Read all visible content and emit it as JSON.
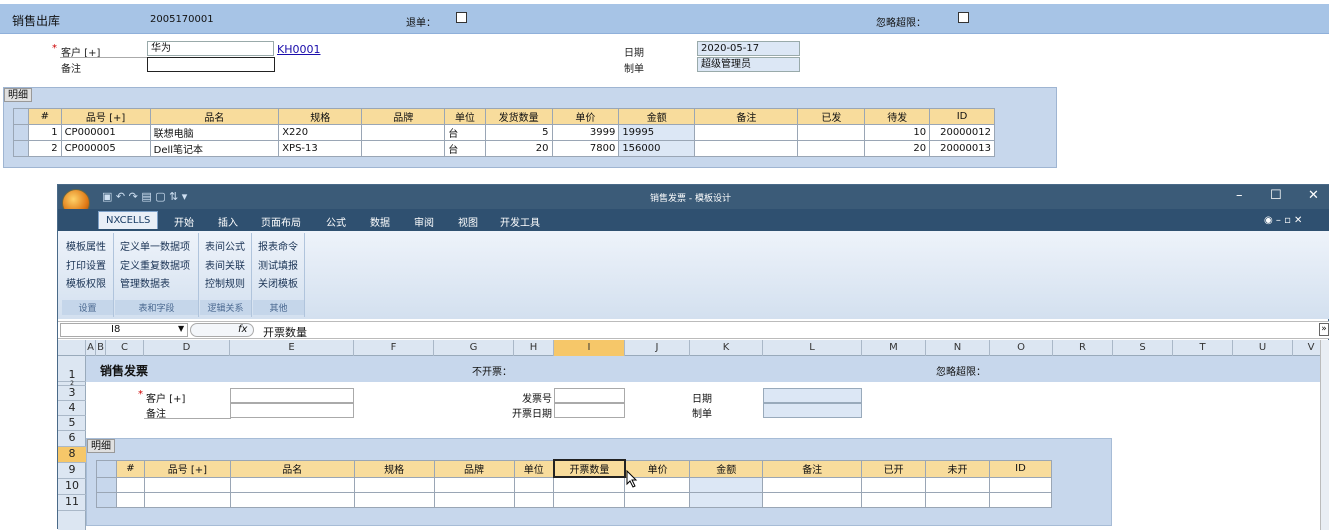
{
  "header": {
    "title": "销售出库",
    "doc_no": "2005170001",
    "return_label": "退单：",
    "ignore_label": "忽略超限："
  },
  "form": {
    "customer_label": "客户 [+]",
    "customer_value": "华为",
    "customer_code": "KH0001",
    "note_label": "备注",
    "note_value": "",
    "date_label": "日期",
    "date_value": "2020-05-17",
    "maker_label": "制单",
    "maker_value": "超级管理员"
  },
  "detail": {
    "tab": "明细",
    "columns": [
      "#",
      "品号 [+]",
      "品名",
      "规格",
      "品牌",
      "单位",
      "发货数量",
      "单价",
      "金额",
      "备注",
      "已发",
      "待发",
      "ID"
    ],
    "rows": [
      [
        "1",
        "CP000001",
        "联想电脑",
        "X220",
        "",
        "台",
        "5",
        "3999",
        "19995",
        "",
        "",
        "10",
        "20000012"
      ],
      [
        "2",
        "CP000005",
        "Dell笔记本",
        "XPS-13",
        "",
        "台",
        "20",
        "7800",
        "156000",
        "",
        "",
        "20",
        "20000013"
      ]
    ]
  },
  "excel": {
    "window_title": "销售发票 - 模板设计",
    "controls": {
      "min": "–",
      "max": "☐",
      "close": "✕"
    },
    "tabs": [
      "NXCELLS",
      "开始",
      "插入",
      "页面布局",
      "公式",
      "数据",
      "审阅",
      "视图",
      "开发工具"
    ],
    "groups": [
      {
        "name": "设置",
        "items": [
          "模板属性",
          "打印设置",
          "模板权限"
        ]
      },
      {
        "name": "表和字段",
        "items": [
          "定义单一数据项",
          "定义重复数据项",
          "管理数据表"
        ]
      },
      {
        "name": "逻辑关系",
        "items": [
          "表间公式",
          "表间关联",
          "控制规则"
        ]
      },
      {
        "name": "其他",
        "items": [
          "报表命令",
          "测试填报",
          "关闭模板"
        ]
      }
    ],
    "name_box": "I8",
    "fx": "fx",
    "formula": "开票数量",
    "columns": [
      "A",
      "B",
      "C",
      "D",
      "E",
      "F",
      "G",
      "H",
      "I",
      "J",
      "K",
      "L",
      "M",
      "N",
      "O",
      "R",
      "S",
      "T",
      "U",
      "V"
    ],
    "rows": [
      "1",
      "2",
      "3",
      "4",
      "5",
      "6",
      "8",
      "9",
      "10",
      "11"
    ],
    "sheet": {
      "title": "销售发票",
      "no_invoice": "不开票：",
      "ignore": "忽略超限：",
      "customer_label": "客户 [+]",
      "note_label": "备注",
      "invoice_no_label": "发票号",
      "invoice_date_label": "开票日期",
      "date_label": "日期",
      "maker_label": "制单",
      "tab": "明细",
      "columns": [
        "#",
        "品号 [+]",
        "品名",
        "规格",
        "品牌",
        "单位",
        "开票数量",
        "单价",
        "金额",
        "备注",
        "已开",
        "未开",
        "ID"
      ]
    }
  }
}
